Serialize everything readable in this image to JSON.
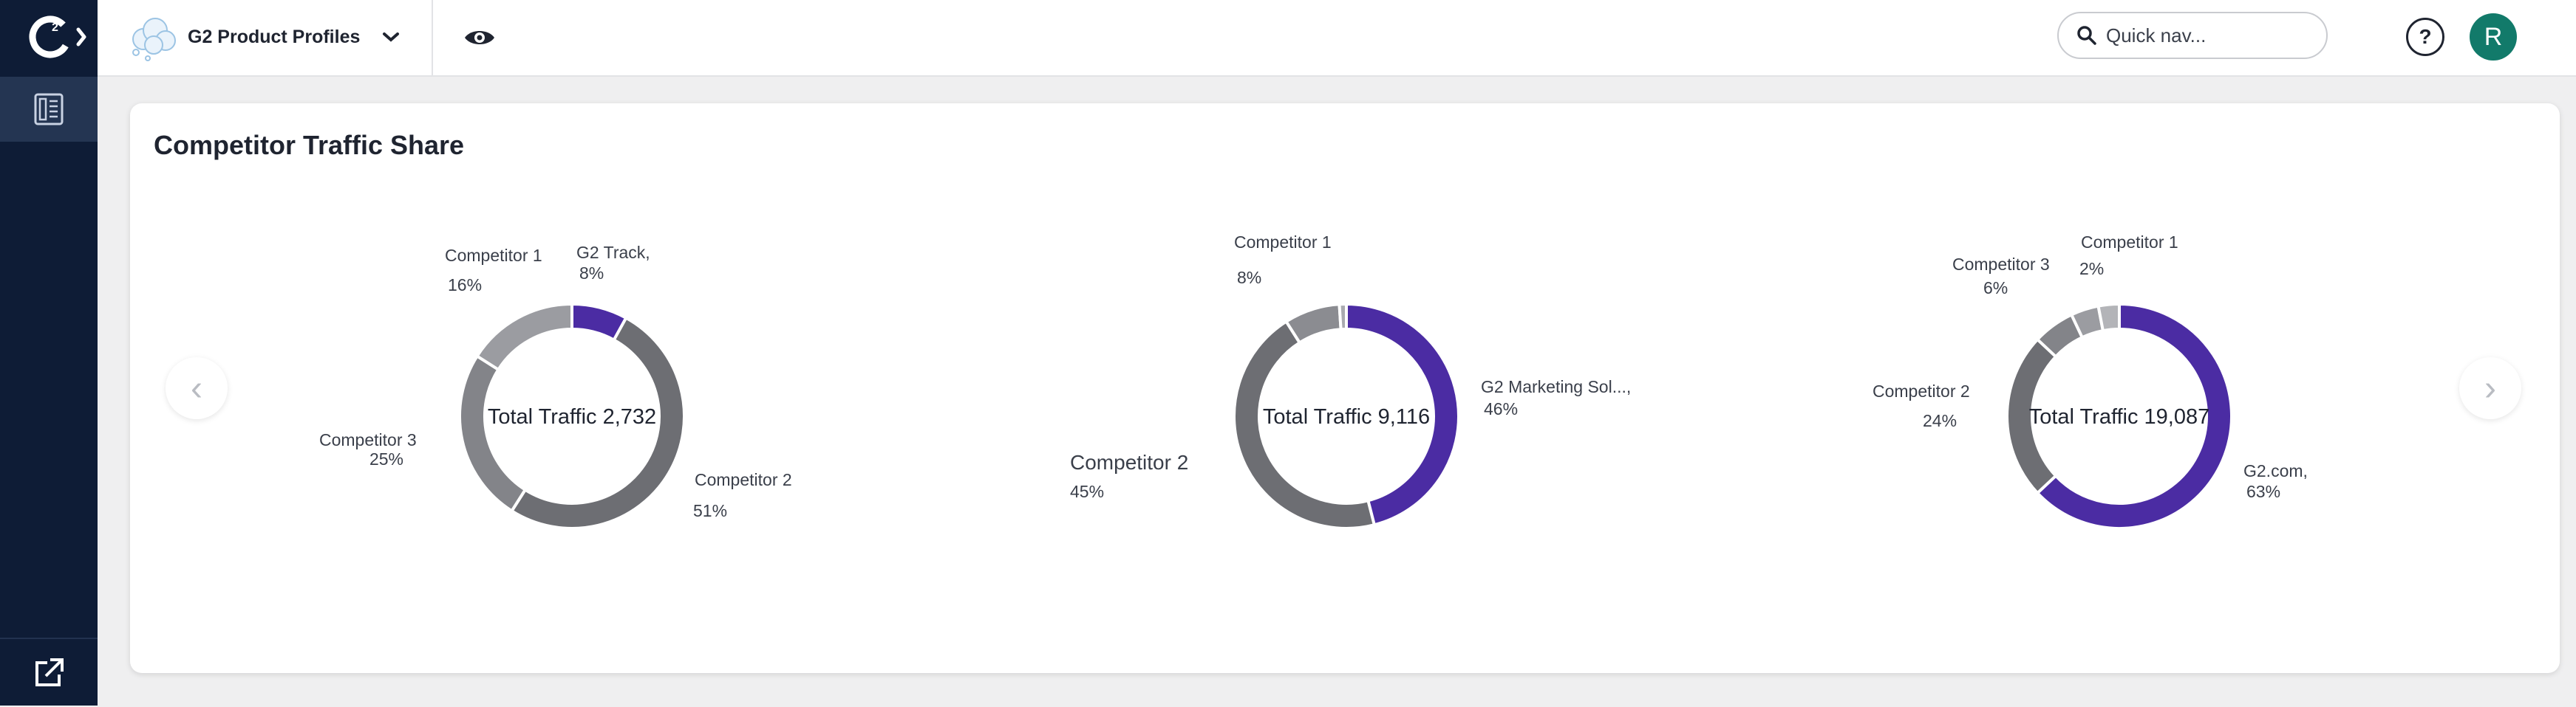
{
  "app": {
    "product_name": "G2 Product Profiles",
    "logo_text": "G2",
    "accent": "#4b2ca3",
    "rail_bg": "#0e1c36",
    "avatar_bg": "#127a6a"
  },
  "search": {
    "placeholder": "Quick nav...",
    "value": ""
  },
  "header": {
    "help_label": "?",
    "avatar_initial": "R"
  },
  "card": {
    "title": "Competitor Traffic Share"
  },
  "icons": {
    "logo": "g2-logo-icon",
    "expand": "chevron-right-icon",
    "reports": "reports-icon",
    "external": "external-link-icon",
    "product": "cloud-logo-icon",
    "dropdown": "chevron-down-icon",
    "preview": "eye-icon",
    "search": "search-icon",
    "help": "help-icon",
    "prev": "chevron-left-icon",
    "next": "chevron-right-icon"
  },
  "carousel": {
    "prev": "‹",
    "next": "›"
  },
  "chart_data": [
    {
      "type": "pie",
      "center_label": "Total Traffic 2,732",
      "slices": [
        {
          "name": "G2 Track,",
          "percent": "8%",
          "value": 8,
          "color": "#4b2ca3"
        },
        {
          "name": "Competitor 2",
          "percent": "51%",
          "value": 51,
          "color": "#6d6e73"
        },
        {
          "name": "Competitor 3",
          "percent": "25%",
          "value": 25,
          "color": "#838489"
        },
        {
          "name": "Competitor 1",
          "percent": "16%",
          "value": 16,
          "color": "#9b9ca1"
        }
      ]
    },
    {
      "type": "pie",
      "center_label": "Total Traffic 9,116",
      "slices": [
        {
          "name": "G2 Marketing Sol...,",
          "percent": "46%",
          "value": 46,
          "color": "#4b2ca3"
        },
        {
          "name": "Competitor 2",
          "percent": "45%",
          "value": 45,
          "color": "#6d6e73"
        },
        {
          "name": "Competitor 1",
          "percent": "8%",
          "value": 8,
          "color": "#8b8c91"
        },
        {
          "name": "",
          "percent": "",
          "value": 1,
          "color": "#a9aaaf"
        }
      ]
    },
    {
      "type": "pie",
      "center_label": "Total Traffic 19,087",
      "slices": [
        {
          "name": "G2.com,",
          "percent": "63%",
          "value": 63,
          "color": "#4b2ca3"
        },
        {
          "name": "Competitor 2",
          "percent": "24%",
          "value": 24,
          "color": "#6d6e73"
        },
        {
          "name": "Competitor 3",
          "percent": "6%",
          "value": 6,
          "color": "#838489"
        },
        {
          "name": "",
          "percent": "2%",
          "value": 4,
          "color": "#9b9ca1"
        },
        {
          "name": "Competitor 1",
          "percent": "",
          "value": 3,
          "color": "#b3b4b8"
        }
      ]
    }
  ]
}
